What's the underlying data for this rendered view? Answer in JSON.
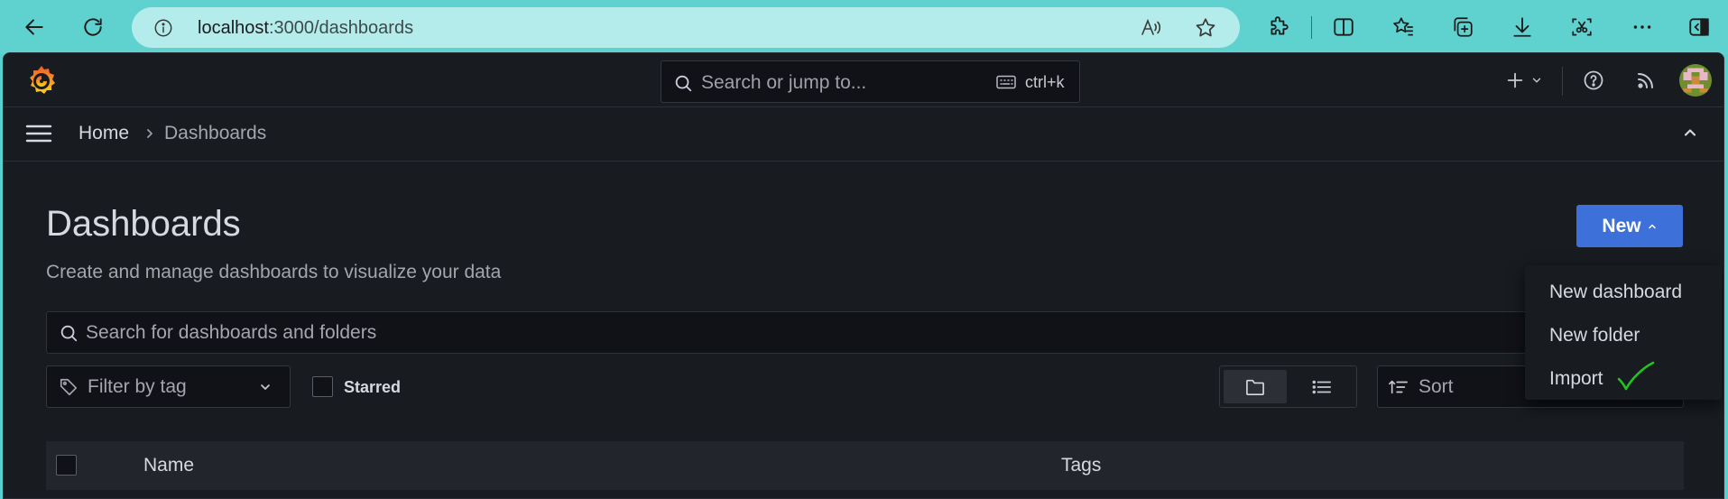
{
  "browser": {
    "url_host": "localhost",
    "url_path": ":3000/dashboards"
  },
  "app": {
    "search": {
      "placeholder": "Search or jump to...",
      "shortcut": "ctrl+k"
    },
    "breadcrumb": {
      "home": "Home",
      "current": "Dashboards"
    },
    "page": {
      "title": "Dashboards",
      "subtitle": "Create and manage dashboards to visualize your data"
    },
    "new_button": {
      "label": "New"
    },
    "new_menu": {
      "items": [
        "New dashboard",
        "New folder",
        "Import"
      ]
    },
    "filters": {
      "search_placeholder": "Search for dashboards and folders",
      "tag_placeholder": "Filter by tag",
      "starred_label": "Starred",
      "sort_placeholder": "Sort"
    },
    "table": {
      "columns": [
        "Name",
        "Tags"
      ]
    }
  },
  "colors": {
    "app_bg": "#181b1f",
    "primary": "#3d71d9",
    "browser_bg": "#5fd2d0",
    "annotation_check": "#22c51e"
  },
  "icons": {
    "browser": [
      "back-icon",
      "refresh-icon",
      "info-icon",
      "read-aloud-icon",
      "favorite-star-icon",
      "extensions-icon",
      "split-screen-icon",
      "favorites-icon",
      "collections-icon",
      "download-icon",
      "screenshot-icon",
      "more-icon",
      "sidebar-icon"
    ],
    "app": [
      "grafana-logo-icon",
      "search-icon",
      "keyboard-icon",
      "plus-icon",
      "help-icon",
      "news-rss-icon",
      "menu-icon",
      "chevron-up-icon",
      "tag-icon",
      "chevron-down-icon",
      "folder-view-icon",
      "list-view-icon",
      "sort-icon",
      "checkmark-icon"
    ]
  }
}
